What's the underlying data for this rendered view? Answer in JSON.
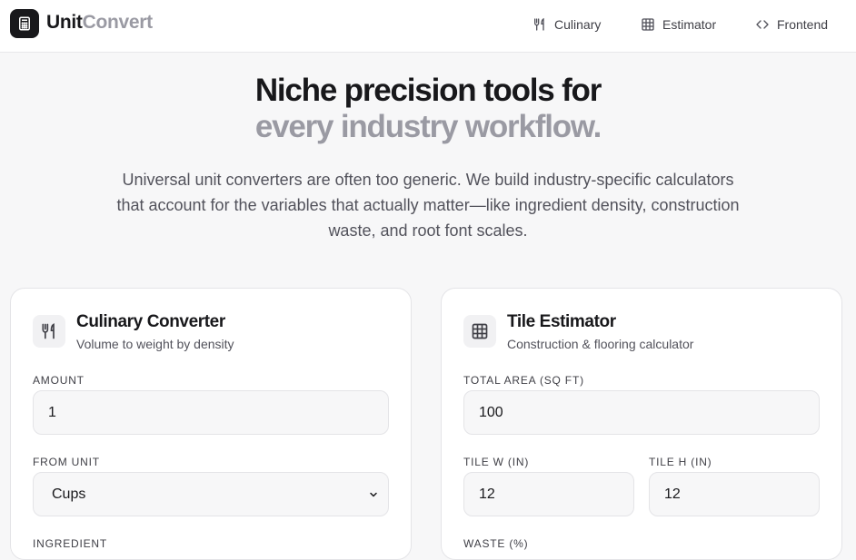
{
  "brand": {
    "part1": "Unit",
    "part2": "Convert"
  },
  "nav": [
    {
      "label": "Culinary",
      "icon": "utensils-icon"
    },
    {
      "label": "Estimator",
      "icon": "grid-icon"
    },
    {
      "label": "Frontend",
      "icon": "code-icon"
    }
  ],
  "hero": {
    "title_line1": "Niche precision tools for",
    "title_line2": "every industry workflow.",
    "subtitle": "Universal unit converters are often too generic. We build industry-specific calculators that account for the variables that actually matter—like ingredient density, construction waste, and root font scales."
  },
  "culinary": {
    "title": "Culinary Converter",
    "subtitle": "Volume to weight by density",
    "amount_label": "AMOUNT",
    "amount_value": "1",
    "from_unit_label": "FROM UNIT",
    "from_unit_value": "Cups",
    "ingredient_label": "INGREDIENT"
  },
  "tile": {
    "title": "Tile Estimator",
    "subtitle": "Construction & flooring calculator",
    "area_label": "TOTAL AREA (SQ FT)",
    "area_value": "100",
    "tile_w_label": "TILE W (IN)",
    "tile_w_value": "12",
    "tile_h_label": "TILE H (IN)",
    "tile_h_value": "12",
    "waste_label": "WASTE (%)"
  },
  "colors": {
    "accent_dark": "#18181b",
    "muted": "#9a9aa3",
    "background": "#f7f7f8"
  }
}
